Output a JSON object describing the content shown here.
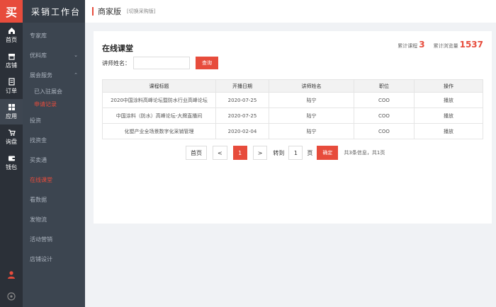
{
  "app": {
    "logo": "买",
    "brand": "采销工作台"
  },
  "rail": [
    {
      "label": "首页",
      "icon": "home-icon"
    },
    {
      "label": "店铺",
      "icon": "store-icon"
    },
    {
      "label": "订单",
      "icon": "order-icon"
    },
    {
      "label": "应用",
      "icon": "apps-icon"
    },
    {
      "label": "询盘",
      "icon": "cart-icon"
    },
    {
      "label": "钱包",
      "icon": "wallet-icon"
    }
  ],
  "nav": {
    "items": [
      {
        "label": "专家库"
      },
      {
        "label": "优料库",
        "chevron": "chevron-down-icon"
      },
      {
        "label": "展会服务",
        "chevron": "chevron-up-icon"
      },
      {
        "label": "已入驻展会"
      },
      {
        "label": "申请记录"
      },
      {
        "label": "投资"
      },
      {
        "label": "找资金"
      },
      {
        "label": "买卖通"
      },
      {
        "label": "在线课堂"
      },
      {
        "label": "看数据"
      },
      {
        "label": "发物流"
      },
      {
        "label": "活动营销"
      },
      {
        "label": "店铺设计"
      }
    ]
  },
  "header": {
    "title": "商家版",
    "switch": "[切换采购版]"
  },
  "page": {
    "title": "在线课堂",
    "stats": {
      "courses_label": "累计课程",
      "courses": "3",
      "views_label": "累计浏览量",
      "views": "1537"
    },
    "search": {
      "label": "讲师姓名：",
      "placeholder": "",
      "button": "查询"
    },
    "table": {
      "headers": [
        "课程标题",
        "开播日期",
        "讲师姓名",
        "职位",
        "操作"
      ],
      "rows": [
        [
          "2020中国涂料高峰论坛暨防水行业高峰论坛",
          "2020-07-25",
          "陆宁",
          "COO",
          "播放"
        ],
        [
          "中国涂料（防水）高峰论坛-大牌直播间",
          "2020-07-25",
          "陆宁",
          "COO",
          "播放"
        ],
        [
          "化塑产业全场景数字化采销管理",
          "2020-02-04",
          "陆宁",
          "COO",
          "播放"
        ]
      ]
    },
    "pager": {
      "first": "首页",
      "prev": "<",
      "current": "1",
      "next": ">",
      "goto_label": "转到",
      "goto_value": "1",
      "page_label": "页",
      "confirm": "确定",
      "info": "共3条信息，共1页"
    }
  },
  "colors": {
    "accent": "#e74c3c",
    "rail": "#2b3038",
    "nav": "#3c4550"
  }
}
